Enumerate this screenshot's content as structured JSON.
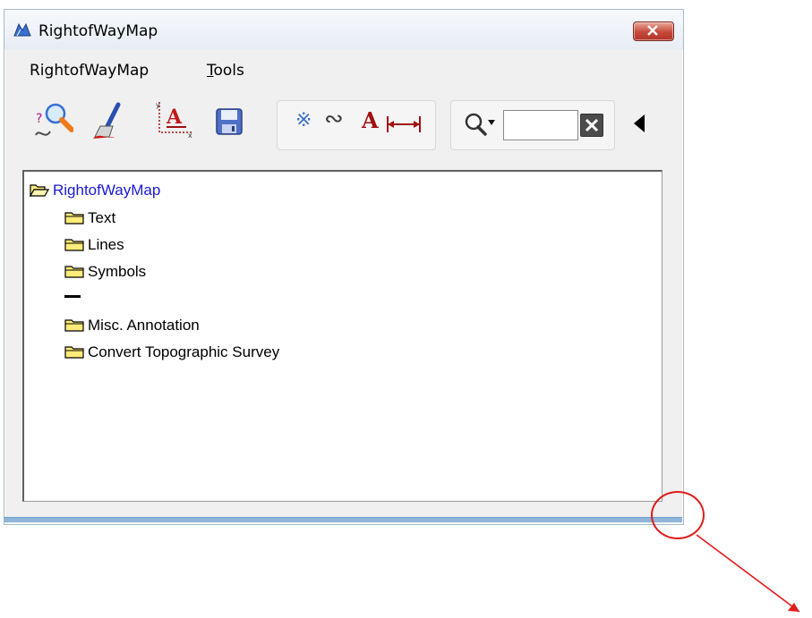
{
  "window": {
    "title": "RightofWayMap",
    "app_icon": "microstation-icon",
    "close_icon": "close-icon"
  },
  "menubar": {
    "items": [
      {
        "label": "RightofWayMap"
      },
      {
        "label_pre": "",
        "label_ul": "T",
        "label_post": "ools"
      }
    ]
  },
  "toolbar": {
    "icons": [
      "find-element-icon",
      "brush-icon",
      "text-axis-icon",
      "save-icon",
      "symbol-icon",
      "curve-icon",
      "text-icon",
      "dimension-icon",
      "search-icon",
      "clear-icon",
      "collapse-left-icon"
    ],
    "group2": {
      "symbol_text": "※",
      "curve_text": "∾",
      "text_text": "A",
      "dim_text": "|↔|"
    },
    "search": {
      "value": "",
      "placeholder": ""
    }
  },
  "tree": {
    "root": {
      "label": "RightofWayMap"
    },
    "children": [
      {
        "label": "Text"
      },
      {
        "label": "Lines"
      },
      {
        "label": "Symbols"
      },
      {
        "label": "Misc. Annotation"
      },
      {
        "label": "Convert Topographic Survey"
      }
    ]
  },
  "colors": {
    "root_link": "#1a1ad6",
    "annotation": "#e11b1b",
    "folder": "#ffec7a"
  }
}
